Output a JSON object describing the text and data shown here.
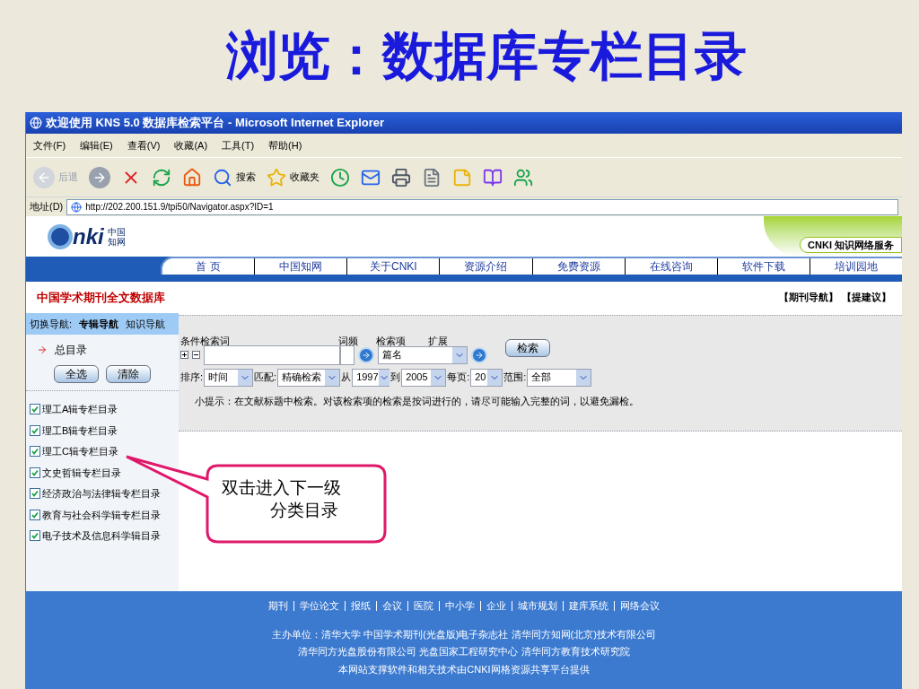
{
  "slide_title": "浏览：数据库专栏目录",
  "browser": {
    "title": "欢迎使用 KNS 5.0 数据库检索平台 - Microsoft Internet Explorer",
    "menu": [
      "文件(F)",
      "编辑(E)",
      "查看(V)",
      "收藏(A)",
      "工具(T)",
      "帮助(H)"
    ],
    "toolbar": [
      {
        "kind": "back",
        "label": "后退",
        "disabled": true
      },
      {
        "kind": "forward",
        "disabled": false
      },
      {
        "kind": "stop"
      },
      {
        "kind": "refresh"
      },
      {
        "kind": "home"
      },
      {
        "kind": "search",
        "label": "搜索"
      },
      {
        "kind": "favorites",
        "label": "收藏夹"
      },
      {
        "kind": "history"
      },
      {
        "kind": "mail"
      },
      {
        "kind": "print"
      },
      {
        "kind": "edit"
      },
      {
        "kind": "note"
      },
      {
        "kind": "research"
      },
      {
        "kind": "messenger"
      }
    ],
    "address_label": "地址(D)",
    "url": "http://202.200.151.9/tpi50/Navigator.aspx?ID=1"
  },
  "site": {
    "logo": {
      "mark": "nki",
      "sub": [
        "中国",
        "知网"
      ]
    },
    "service_badge": "CNKI 知识网络服务",
    "nav": [
      "首 页",
      "中国知网",
      "关于CNKI",
      "资源介绍",
      "免费资源",
      "在线咨询",
      "软件下载",
      "培训园地"
    ],
    "db_title": "中国学术期刊全文数据库",
    "top_links": [
      "【期刊导航】",
      "【提建议】"
    ]
  },
  "sidebar": {
    "switch_label": "切换导航:",
    "tabs": [
      {
        "label": "专辑导航",
        "selected": true
      },
      {
        "label": "知识导航",
        "selected": false
      }
    ],
    "root": "总目录",
    "buttons": [
      "全选",
      "清除"
    ],
    "items": [
      {
        "label": "理工A辑专栏目录",
        "checked": true
      },
      {
        "label": "理工B辑专栏目录",
        "checked": true
      },
      {
        "label": "理工C辑专栏目录",
        "checked": true
      },
      {
        "label": "文史哲辑专栏目录",
        "checked": true
      },
      {
        "label": "经济政治与法律辑专栏目录",
        "checked": true
      },
      {
        "label": "教育与社会科学辑专栏目录",
        "checked": true
      },
      {
        "label": "电子技术及信息科学辑目录",
        "checked": true
      }
    ]
  },
  "search": {
    "headers": [
      "条件检索词",
      "词频",
      "检索项",
      "扩展"
    ],
    "field_select": "篇名",
    "search_button": "检索",
    "options": [
      {
        "label": "排序:",
        "value": "时间"
      },
      {
        "label": "匹配:",
        "value": "精确检索"
      },
      {
        "label": "从",
        "value": "1997"
      },
      {
        "label": "到",
        "value": "2005"
      },
      {
        "label": "每页:",
        "value": "20"
      },
      {
        "label": "范围:",
        "value": "全部"
      }
    ],
    "hint": "小提示：在文献标题中检索。对该检索项的检索是按词进行的，请尽可能输入完整的词，以避免漏检。"
  },
  "callout": [
    "双击进入下一级",
    "分类目录"
  ],
  "footer": {
    "links": [
      "期刊",
      "学位论文",
      "报纸",
      "会议",
      "医院",
      "中小学",
      "企业",
      "城市规划",
      "建库系统",
      "网络会议"
    ],
    "lines": [
      "主办单位：清华大学 中国学术期刊(光盘版)电子杂志社 清华同方知网(北京)技术有限公司",
      "清华同方光盘股份有限公司 光盘国家工程研究中心 清华同方教育技术研究院",
      "本网站支撑软件和相关技术由CNKI网格资源共享平台提供"
    ]
  }
}
